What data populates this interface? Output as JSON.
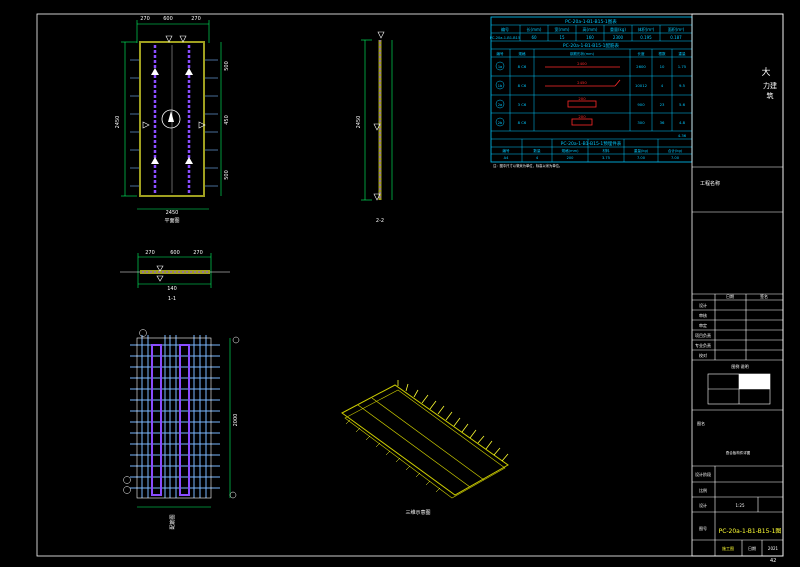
{
  "drawing": {
    "plan_title": "平面图",
    "section_2_2": "2-2",
    "section_1_1": "1-1",
    "rebar_title": "配筋图",
    "iso_title": "三维示意图",
    "sheet_number": "42",
    "colors": {
      "background": "#000000",
      "frame": "#ffffff",
      "panel": "#8a8a1e",
      "dim": "#00ff66",
      "rebar": "#8a4dff",
      "rebar_light": "#7ab8ff",
      "table": "#00c8ff",
      "red": "#ff2a2a",
      "yellow": "#ffff33"
    },
    "dims": {
      "top": [
        "270",
        "600",
        "270"
      ],
      "bottom_total": "2450",
      "left": "2450",
      "right": [
        "500",
        "450",
        "500"
      ],
      "mid": "140",
      "rebar_vertical": "2000"
    }
  },
  "table": {
    "title": "PC-20a-1-B1-B15-1图表",
    "header_cols": [
      "编号",
      "长(mm)",
      "宽(mm)",
      "高(mm)",
      "重量(kg)",
      "体积(m³)",
      "面积(m²)"
    ],
    "header_row": [
      "PC-20a-1-B1-B15",
      "60",
      "15",
      "160",
      "2300",
      "0.195",
      "0.187"
    ],
    "rebar_title": "PC-20a-1-B1-B15-1配筋表",
    "rebar_cols": [
      "编号",
      "规格",
      "钢筋形状(mm)",
      "长度",
      "根数",
      "重量"
    ],
    "rows": [
      {
        "id": "1a",
        "spec": "8 C6",
        "shape": "2400",
        "len": "2600",
        "count": "10",
        "weight": "1.75"
      },
      {
        "id": "1b",
        "spec": "8 C6",
        "shape": "2450",
        "len": "10012",
        "count": "4",
        "weight": "9.5"
      },
      {
        "id": "2a",
        "spec": "3 C6",
        "shape": "200",
        "len": "900",
        "count": "23",
        "weight": "5.6"
      },
      {
        "id": "2b",
        "spec": "8 C6",
        "shape": "200",
        "len": "300",
        "count": "36",
        "weight": "4.8"
      }
    ],
    "total_weight": "4.36",
    "emb_title": "PC-20a-1-B1-B15-1预埋件表",
    "emb_cols": [
      "编号",
      "数量",
      "规格(mm)",
      "材料",
      "重量(kg)",
      "合计(kg)"
    ],
    "emb_row": [
      "A4",
      "4",
      "200",
      "3.75",
      "7.00",
      "7.00"
    ],
    "note": "注：图中尺寸以毫米为单位，标高以米为单位。"
  },
  "title_block": {
    "logo_text": "大\n力建\n筑",
    "project_label": "工程名称",
    "cols": [
      "日期",
      "签名"
    ],
    "roles": [
      "设计",
      "审核",
      "审定",
      "项目负责",
      "专业负责",
      "校对",
      "设计",
      "制图"
    ],
    "legend_title": "图例 说明",
    "drawing_label": "图名",
    "drawing_name": "叠合板构件详图",
    "scale_label": "比例",
    "scale_value": "1:25",
    "stage_label": "设计阶段",
    "number_label": "图号",
    "number_value": "PC-20a-1-B1-B15-1图",
    "bottom_left": "施工图",
    "bottom_mid": "日期",
    "bottom_right": "2021"
  }
}
